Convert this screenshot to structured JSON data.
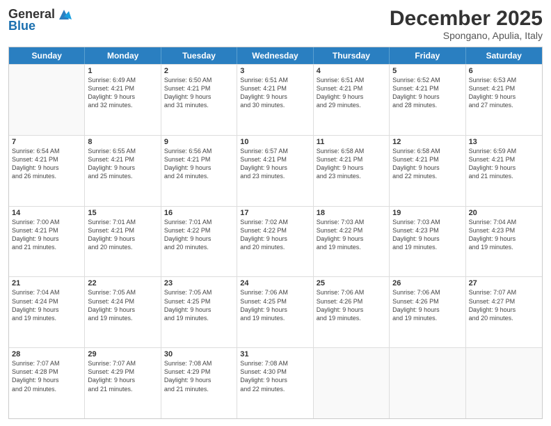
{
  "logo": {
    "general": "General",
    "blue": "Blue"
  },
  "header": {
    "month": "December 2025",
    "location": "Spongano, Apulia, Italy"
  },
  "weekdays": [
    "Sunday",
    "Monday",
    "Tuesday",
    "Wednesday",
    "Thursday",
    "Friday",
    "Saturday"
  ],
  "weeks": [
    [
      {
        "day": "",
        "info": ""
      },
      {
        "day": "1",
        "info": "Sunrise: 6:49 AM\nSunset: 4:21 PM\nDaylight: 9 hours\nand 32 minutes."
      },
      {
        "day": "2",
        "info": "Sunrise: 6:50 AM\nSunset: 4:21 PM\nDaylight: 9 hours\nand 31 minutes."
      },
      {
        "day": "3",
        "info": "Sunrise: 6:51 AM\nSunset: 4:21 PM\nDaylight: 9 hours\nand 30 minutes."
      },
      {
        "day": "4",
        "info": "Sunrise: 6:51 AM\nSunset: 4:21 PM\nDaylight: 9 hours\nand 29 minutes."
      },
      {
        "day": "5",
        "info": "Sunrise: 6:52 AM\nSunset: 4:21 PM\nDaylight: 9 hours\nand 28 minutes."
      },
      {
        "day": "6",
        "info": "Sunrise: 6:53 AM\nSunset: 4:21 PM\nDaylight: 9 hours\nand 27 minutes."
      }
    ],
    [
      {
        "day": "7",
        "info": "Sunrise: 6:54 AM\nSunset: 4:21 PM\nDaylight: 9 hours\nand 26 minutes."
      },
      {
        "day": "8",
        "info": "Sunrise: 6:55 AM\nSunset: 4:21 PM\nDaylight: 9 hours\nand 25 minutes."
      },
      {
        "day": "9",
        "info": "Sunrise: 6:56 AM\nSunset: 4:21 PM\nDaylight: 9 hours\nand 24 minutes."
      },
      {
        "day": "10",
        "info": "Sunrise: 6:57 AM\nSunset: 4:21 PM\nDaylight: 9 hours\nand 23 minutes."
      },
      {
        "day": "11",
        "info": "Sunrise: 6:58 AM\nSunset: 4:21 PM\nDaylight: 9 hours\nand 23 minutes."
      },
      {
        "day": "12",
        "info": "Sunrise: 6:58 AM\nSunset: 4:21 PM\nDaylight: 9 hours\nand 22 minutes."
      },
      {
        "day": "13",
        "info": "Sunrise: 6:59 AM\nSunset: 4:21 PM\nDaylight: 9 hours\nand 21 minutes."
      }
    ],
    [
      {
        "day": "14",
        "info": "Sunrise: 7:00 AM\nSunset: 4:21 PM\nDaylight: 9 hours\nand 21 minutes."
      },
      {
        "day": "15",
        "info": "Sunrise: 7:01 AM\nSunset: 4:21 PM\nDaylight: 9 hours\nand 20 minutes."
      },
      {
        "day": "16",
        "info": "Sunrise: 7:01 AM\nSunset: 4:22 PM\nDaylight: 9 hours\nand 20 minutes."
      },
      {
        "day": "17",
        "info": "Sunrise: 7:02 AM\nSunset: 4:22 PM\nDaylight: 9 hours\nand 20 minutes."
      },
      {
        "day": "18",
        "info": "Sunrise: 7:03 AM\nSunset: 4:22 PM\nDaylight: 9 hours\nand 19 minutes."
      },
      {
        "day": "19",
        "info": "Sunrise: 7:03 AM\nSunset: 4:23 PM\nDaylight: 9 hours\nand 19 minutes."
      },
      {
        "day": "20",
        "info": "Sunrise: 7:04 AM\nSunset: 4:23 PM\nDaylight: 9 hours\nand 19 minutes."
      }
    ],
    [
      {
        "day": "21",
        "info": "Sunrise: 7:04 AM\nSunset: 4:24 PM\nDaylight: 9 hours\nand 19 minutes."
      },
      {
        "day": "22",
        "info": "Sunrise: 7:05 AM\nSunset: 4:24 PM\nDaylight: 9 hours\nand 19 minutes."
      },
      {
        "day": "23",
        "info": "Sunrise: 7:05 AM\nSunset: 4:25 PM\nDaylight: 9 hours\nand 19 minutes."
      },
      {
        "day": "24",
        "info": "Sunrise: 7:06 AM\nSunset: 4:25 PM\nDaylight: 9 hours\nand 19 minutes."
      },
      {
        "day": "25",
        "info": "Sunrise: 7:06 AM\nSunset: 4:26 PM\nDaylight: 9 hours\nand 19 minutes."
      },
      {
        "day": "26",
        "info": "Sunrise: 7:06 AM\nSunset: 4:26 PM\nDaylight: 9 hours\nand 19 minutes."
      },
      {
        "day": "27",
        "info": "Sunrise: 7:07 AM\nSunset: 4:27 PM\nDaylight: 9 hours\nand 20 minutes."
      }
    ],
    [
      {
        "day": "28",
        "info": "Sunrise: 7:07 AM\nSunset: 4:28 PM\nDaylight: 9 hours\nand 20 minutes."
      },
      {
        "day": "29",
        "info": "Sunrise: 7:07 AM\nSunset: 4:29 PM\nDaylight: 9 hours\nand 21 minutes."
      },
      {
        "day": "30",
        "info": "Sunrise: 7:08 AM\nSunset: 4:29 PM\nDaylight: 9 hours\nand 21 minutes."
      },
      {
        "day": "31",
        "info": "Sunrise: 7:08 AM\nSunset: 4:30 PM\nDaylight: 9 hours\nand 22 minutes."
      },
      {
        "day": "",
        "info": ""
      },
      {
        "day": "",
        "info": ""
      },
      {
        "day": "",
        "info": ""
      }
    ]
  ]
}
